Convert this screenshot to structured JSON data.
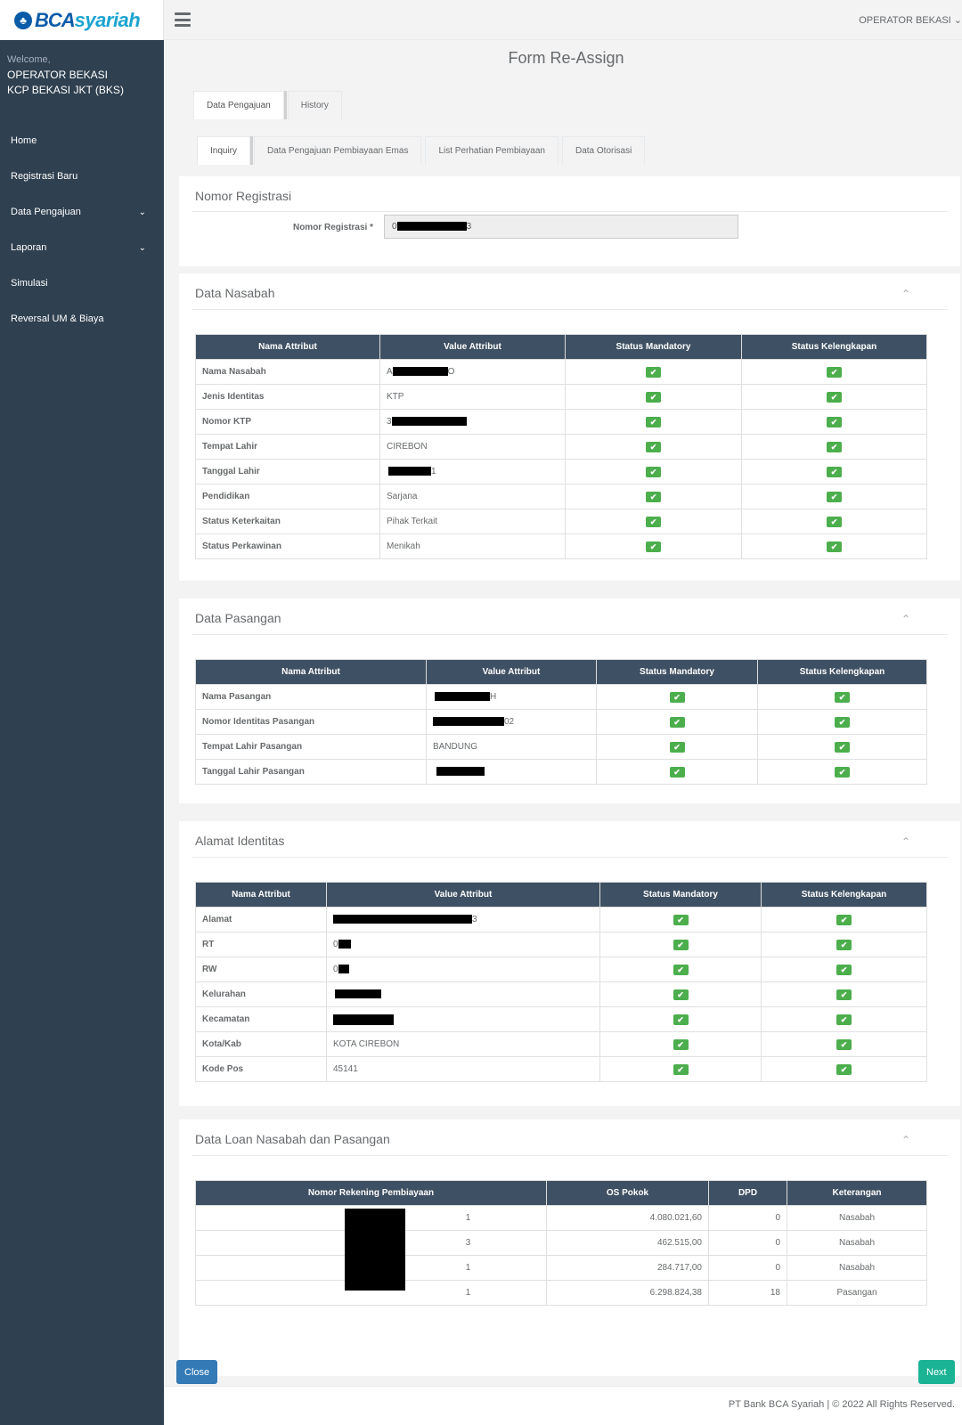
{
  "brand": {
    "logo_part1": "BCA",
    "logo_part2": "syariah",
    "logo_icon": "bca-emblem-icon"
  },
  "sidebar": {
    "welcome": "Welcome,",
    "user": "OPERATOR BEKASI",
    "branch": "KCP BEKASI JKT (BKS)",
    "items": [
      {
        "label": "Home",
        "chevron": false
      },
      {
        "label": "Registrasi Baru",
        "chevron": false
      },
      {
        "label": "Data Pengajuan",
        "chevron": true
      },
      {
        "label": "Laporan",
        "chevron": true
      },
      {
        "label": "Simulasi",
        "chevron": false
      },
      {
        "label": "Reversal UM & Biaya",
        "chevron": false
      }
    ]
  },
  "topbar": {
    "user_menu": "OPERATOR BEKASI"
  },
  "page": {
    "title": "Form Re-Assign"
  },
  "tabs_main": [
    {
      "label": "Data Pengajuan",
      "active": true
    },
    {
      "label": "History",
      "active": false
    }
  ],
  "tabs_sub": [
    {
      "label": "Inquiry",
      "active": true
    },
    {
      "label": "Data Pengajuan Pembiayaan Emas",
      "active": false
    },
    {
      "label": "List Perhatian Pembiayaan",
      "active": false
    },
    {
      "label": "Data Otorisasi",
      "active": false
    }
  ],
  "registrasi": {
    "title": "Nomor Registrasi",
    "label": "Nomor Registrasi *",
    "value_prefix": "0",
    "value_suffix": "3"
  },
  "headers": {
    "nama": "Nama Attribut",
    "value": "Value Attribut",
    "mandatory": "Status Mandatory",
    "kelengkapan": "Status Kelengkapan"
  },
  "nasabah": {
    "title": "Data Nasabah",
    "rows": [
      {
        "attr": "Nama Nasabah",
        "pre": "A",
        "post": "O"
      },
      {
        "attr": "Jenis Identitas",
        "pre": "KTP",
        "post": ""
      },
      {
        "attr": "Nomor KTP",
        "pre": "3",
        "post": ""
      },
      {
        "attr": "Tempat Lahir",
        "pre": "CIREBON",
        "post": ""
      },
      {
        "attr": "Tanggal Lahir",
        "pre": "",
        "post": "1"
      },
      {
        "attr": "Pendidikan",
        "pre": "Sarjana",
        "post": ""
      },
      {
        "attr": "Status Keterkaitan",
        "pre": "Pihak Terkait",
        "post": ""
      },
      {
        "attr": "Status Perkawinan",
        "pre": "Menikah",
        "post": ""
      }
    ]
  },
  "pasangan": {
    "title": "Data Pasangan",
    "rows": [
      {
        "attr": "Nama Pasangan",
        "pre": "",
        "post": "H"
      },
      {
        "attr": "Nomor Identitas Pasangan",
        "pre": "",
        "post": "02"
      },
      {
        "attr": "Tempat Lahir Pasangan",
        "pre": "BANDUNG",
        "post": ""
      },
      {
        "attr": "Tanggal Lahir Pasangan",
        "pre": "",
        "post": ""
      }
    ]
  },
  "alamat": {
    "title": "Alamat Identitas",
    "rows": [
      {
        "attr": "Alamat",
        "pre": "",
        "post": "3"
      },
      {
        "attr": "RT",
        "pre": "0",
        "post": ""
      },
      {
        "attr": "RW",
        "pre": "0",
        "post": ""
      },
      {
        "attr": "Kelurahan",
        "pre": "",
        "post": ""
      },
      {
        "attr": "Kecamatan",
        "pre": "",
        "post": ""
      },
      {
        "attr": "Kota/Kab",
        "pre": "KOTA CIREBON",
        "post": ""
      },
      {
        "attr": "Kode Pos",
        "pre": "45141",
        "post": ""
      }
    ]
  },
  "loan": {
    "title": "Data Loan Nasabah dan Pasangan",
    "headers": {
      "rek": "Nomor Rekening Pembiayaan",
      "os": "OS Pokok",
      "dpd": "DPD",
      "ket": "Keterangan"
    },
    "rows": [
      {
        "rek_suffix": "1",
        "os": "4.080.021,60",
        "dpd": "0",
        "ket": "Nasabah"
      },
      {
        "rek_suffix": "3",
        "os": "462.515,00",
        "dpd": "0",
        "ket": "Nasabah"
      },
      {
        "rek_suffix": "1",
        "os": "284.717,00",
        "dpd": "0",
        "ket": "Nasabah"
      },
      {
        "rek_suffix": "1",
        "os": "6.298.824,38",
        "dpd": "18",
        "ket": "Pasangan"
      }
    ]
  },
  "buttons": {
    "close": "Close",
    "next": "Next"
  },
  "footer": "PT Bank BCA Syariah | © 2022 All Rights Reserved."
}
